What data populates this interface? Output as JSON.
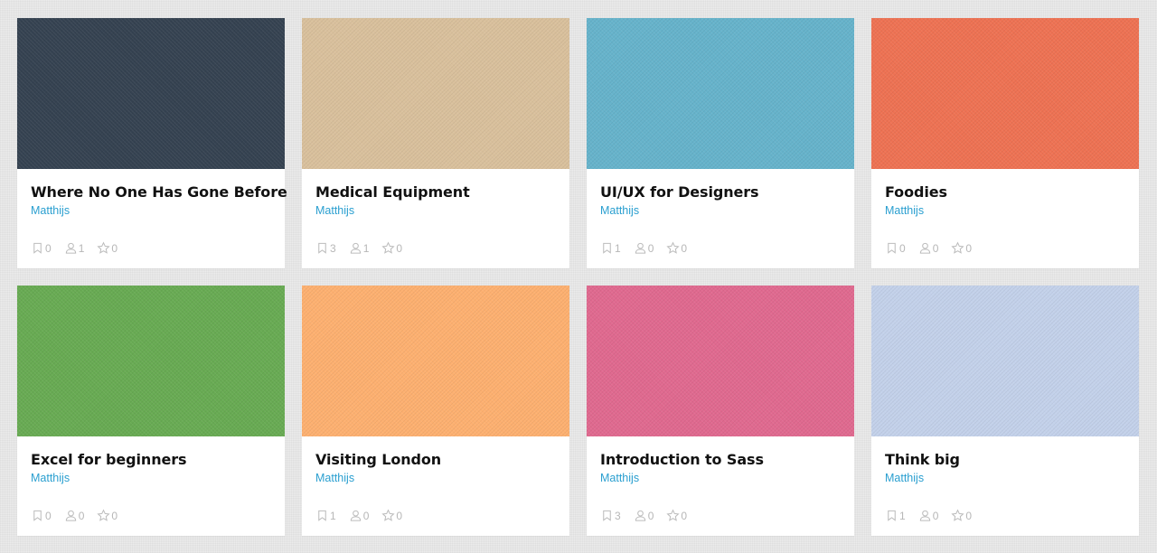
{
  "cards": [
    {
      "title": "Where No One Has Gone Before",
      "author": "Matthijs",
      "color": "#354251",
      "bookmarks": "0",
      "users": "1",
      "stars": "0"
    },
    {
      "title": "Medical Equipment",
      "author": "Matthijs",
      "color": "#d9c09c",
      "bookmarks": "3",
      "users": "1",
      "stars": "0"
    },
    {
      "title": "UI/UX for Designers",
      "author": "Matthijs",
      "color": "#66b3cb",
      "bookmarks": "1",
      "users": "0",
      "stars": "0"
    },
    {
      "title": "Foodies",
      "author": "Matthijs",
      "color": "#ee7253",
      "bookmarks": "0",
      "users": "0",
      "stars": "0"
    },
    {
      "title": "Excel for beginners",
      "author": "Matthijs",
      "color": "#68ab53",
      "bookmarks": "0",
      "users": "0",
      "stars": "0"
    },
    {
      "title": "Visiting London",
      "author": "Matthijs",
      "color": "#fdb070",
      "bookmarks": "1",
      "users": "0",
      "stars": "0"
    },
    {
      "title": "Introduction to Sass",
      "author": "Matthijs",
      "color": "#e0698f",
      "bookmarks": "3",
      "users": "0",
      "stars": "0"
    },
    {
      "title": "Think big",
      "author": "Matthijs",
      "color": "#c3d1ea",
      "bookmarks": "1",
      "users": "0",
      "stars": "0"
    }
  ]
}
